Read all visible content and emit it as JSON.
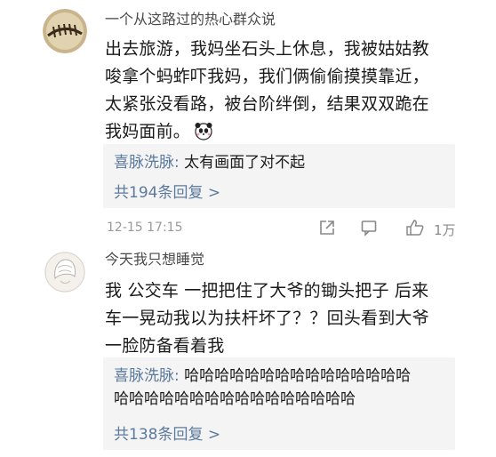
{
  "comments": [
    {
      "username": "一个从这路过的热心群众说",
      "lines": [
        "出去旅游，我妈坐石头上休息，我被姑姑教",
        "唆拿个蚂蚱吓我妈，我们俩偷偷摸摸靠近，",
        "太紧张没看路，被台阶绊倒，结果双双跪在",
        "我妈面前。"
      ],
      "emoji": "panda-emoji",
      "reply": {
        "author": "喜脉洗脉:",
        "lines": [
          " 太有画面了对不起"
        ],
        "count": "共194条回复 >"
      },
      "time": "12-15 17:15",
      "likes": "1万"
    },
    {
      "username": "今天我只想睡觉",
      "lines": [
        "我  公交车  一把把住了大爷的锄头把子  后来",
        "车一晃动我以为扶杆坏了？？回头看到大爷",
        "一脸防备看着我"
      ],
      "reply": {
        "author": "喜脉洗脉:",
        "lines": [
          " 哈哈哈哈哈哈哈哈哈哈哈哈哈哈哈",
          "哈哈哈哈哈哈哈哈哈哈哈哈哈哈哈哈"
        ],
        "count": "共138条回复 >"
      }
    }
  ],
  "icons": [
    "share-icon",
    "comment-icon",
    "like-icon"
  ]
}
